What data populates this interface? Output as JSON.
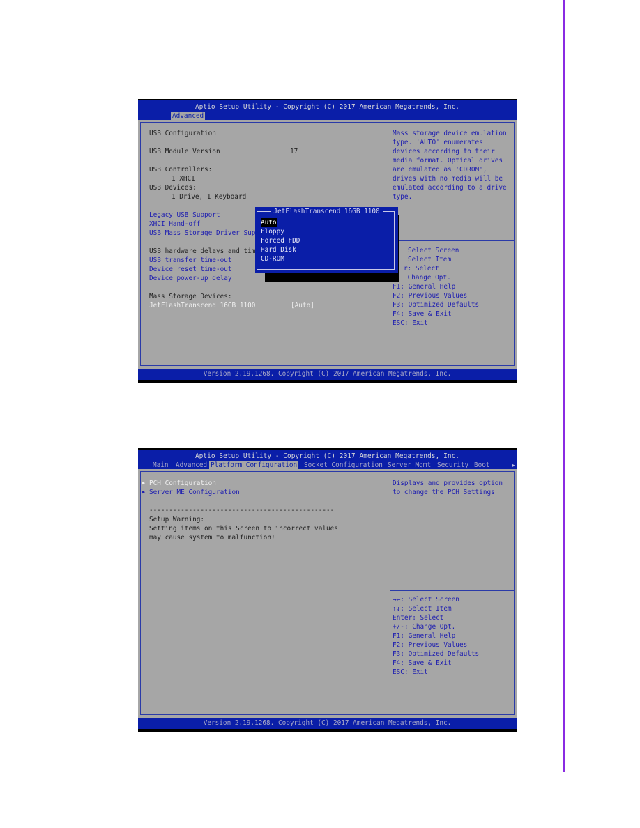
{
  "screens": [
    {
      "header_title": "Aptio Setup Utility - Copyright (C) 2017 American Megatrends, Inc.",
      "tabs": [
        {
          "label": "Advanced",
          "active": true
        }
      ],
      "left": {
        "usb_configuration": "USB Configuration",
        "module_version_label": "USB Module Version",
        "module_version_value": "17",
        "controllers_label": "USB Controllers:",
        "controllers_value": "1 XHCI",
        "devices_label": "USB Devices:",
        "devices_value": "1 Drive, 1 Keyboard",
        "items1": [
          "Legacy USB Support",
          "XHCI Hand-off",
          "USB Mass Storage Driver Supp"
        ],
        "delays_label": "USB hardware delays and time",
        "items2": [
          "USB transfer time-out",
          "Device reset time-out",
          "Device power-up delay"
        ],
        "mass_storage_label": "Mass Storage Devices:",
        "device_name": "JetFlashTranscend 16GB 1100",
        "device_value": "[Auto]"
      },
      "help_text": [
        "Mass storage device emulation",
        "type. 'AUTO' enumerates",
        "devices according to their",
        "media format. Optical drives",
        "are emulated as 'CDROM',",
        "drives with no media will be",
        "emulated according to a drive",
        "type."
      ],
      "keys": [
        "Select Screen",
        "Select Item",
        "r: Select",
        " Change Opt.",
        "F1: General Help",
        "F2: Previous Values",
        "F3: Optimized Defaults",
        "F4: Save & Exit",
        "ESC: Exit"
      ],
      "popup": {
        "title": "JetFlashTranscend 16GB 1100",
        "options": [
          "Auto",
          "Floppy",
          "Forced FDD",
          "Hard Disk",
          "CD-ROM"
        ],
        "selected": "Auto"
      },
      "footer": "Version 2.19.1268. Copyright (C) 2017 American Megatrends, Inc."
    },
    {
      "header_title": "Aptio Setup Utility - Copyright (C) 2017 American Megatrends, Inc.",
      "tabs": [
        {
          "label": "Main",
          "active": false
        },
        {
          "label": "Advanced",
          "active": false
        },
        {
          "label": "Platform Configuration",
          "active": true
        },
        {
          "label": "Socket Configuration",
          "active": false
        },
        {
          "label": "Server Mgmt",
          "active": false
        },
        {
          "label": "Security",
          "active": false
        },
        {
          "label": "Boot",
          "active": false
        }
      ],
      "left": {
        "submenus": [
          "PCH Configuration",
          "Server ME Configuration"
        ],
        "separator": "-----------------------------------------------",
        "warning_title": "Setup Warning:",
        "warning_lines": [
          "Setting items on this Screen to incorrect values",
          "may cause system to malfunction!"
        ]
      },
      "help_text": [
        "Displays and provides option",
        "to change the PCH Settings"
      ],
      "keys": [
        "→←: Select Screen",
        "↑↓: Select Item",
        "Enter: Select",
        "+/-: Change Opt.",
        "F1: General Help",
        "F2: Previous Values",
        "F3: Optimized Defaults",
        "F4: Save & Exit",
        "ESC: Exit"
      ],
      "footer": "Version 2.19.1268. Copyright (C) 2017 American Megatrends, Inc."
    }
  ]
}
